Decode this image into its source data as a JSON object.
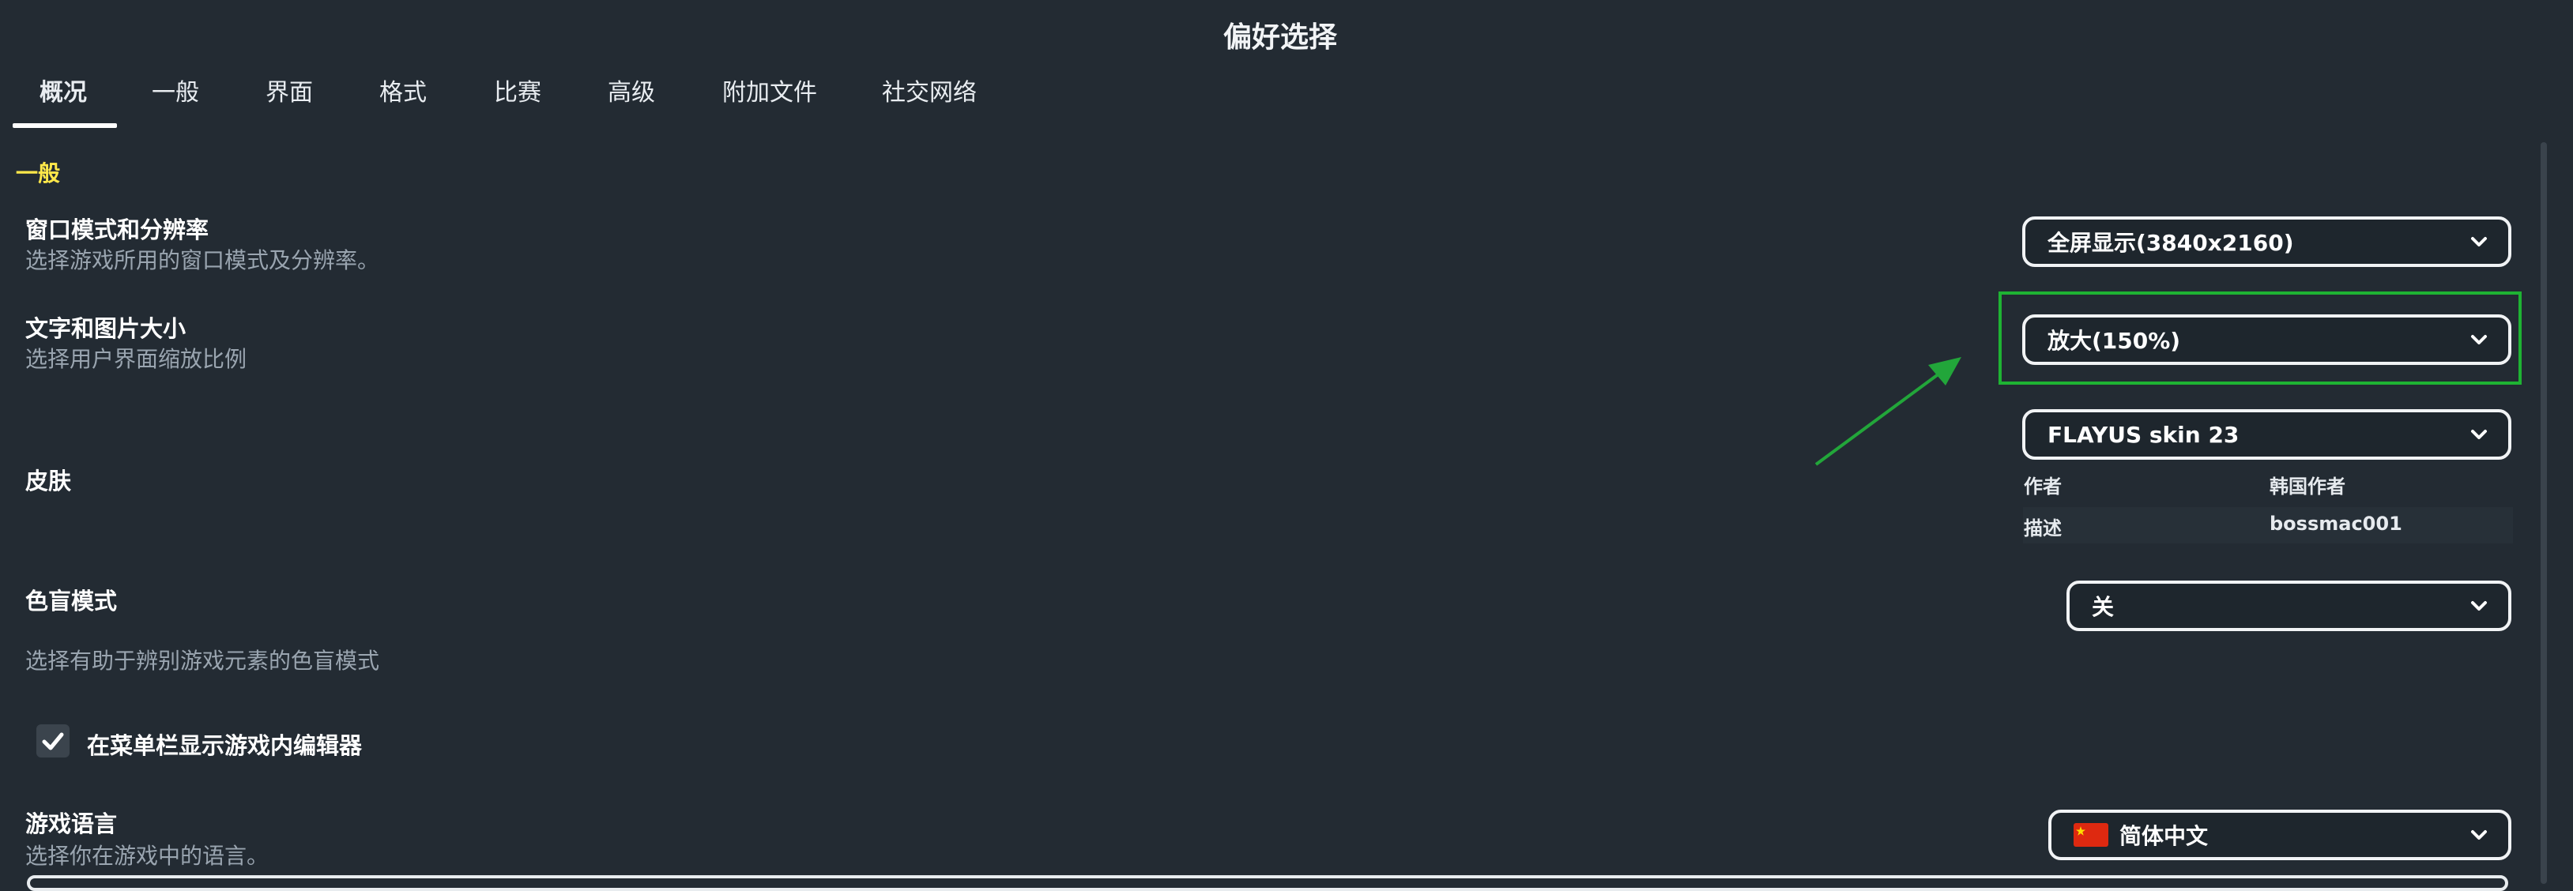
{
  "window": {
    "title": "偏好选择"
  },
  "tabs": [
    {
      "label": "概况"
    },
    {
      "label": "一般"
    },
    {
      "label": "界面"
    },
    {
      "label": "格式"
    },
    {
      "label": "比赛"
    },
    {
      "label": "高级"
    },
    {
      "label": "附加文件"
    },
    {
      "label": "社交网络"
    }
  ],
  "active_tab": "概况",
  "section": {
    "title": "一般"
  },
  "settings": {
    "window_mode": {
      "label": "窗口模式和分辨率",
      "description": "选择游戏所用的窗口模式及分辨率。",
      "value": "全屏显示(3840x2160)"
    },
    "text_size": {
      "label": "文字和图片大小",
      "description": "选择用户界面缩放比例",
      "value": "放大(150%)"
    },
    "skin": {
      "label": "皮肤",
      "value": "FLAYUS skin 23",
      "author_label": "作者",
      "author_value": "韩国作者",
      "desc_label": "描述",
      "desc_value": "bossmac001"
    },
    "colorblind": {
      "label": "色盲模式",
      "description": "选择有助于辨别游戏元素的色盲模式",
      "value": "关"
    },
    "editor_checkbox": {
      "label": "在菜单栏显示游戏内编辑器",
      "checked": true
    },
    "language": {
      "label": "游戏语言",
      "description": "选择你在游戏中的语言。",
      "value": "简体中文",
      "flag_icon": "china-flag-icon"
    }
  },
  "annotation": {
    "highlight_color": "#1eb333",
    "arrow_color": "#22a63a"
  },
  "colors": {
    "background": "#232b33",
    "section_title": "#ffe84a",
    "description": "#9aa5b0"
  }
}
